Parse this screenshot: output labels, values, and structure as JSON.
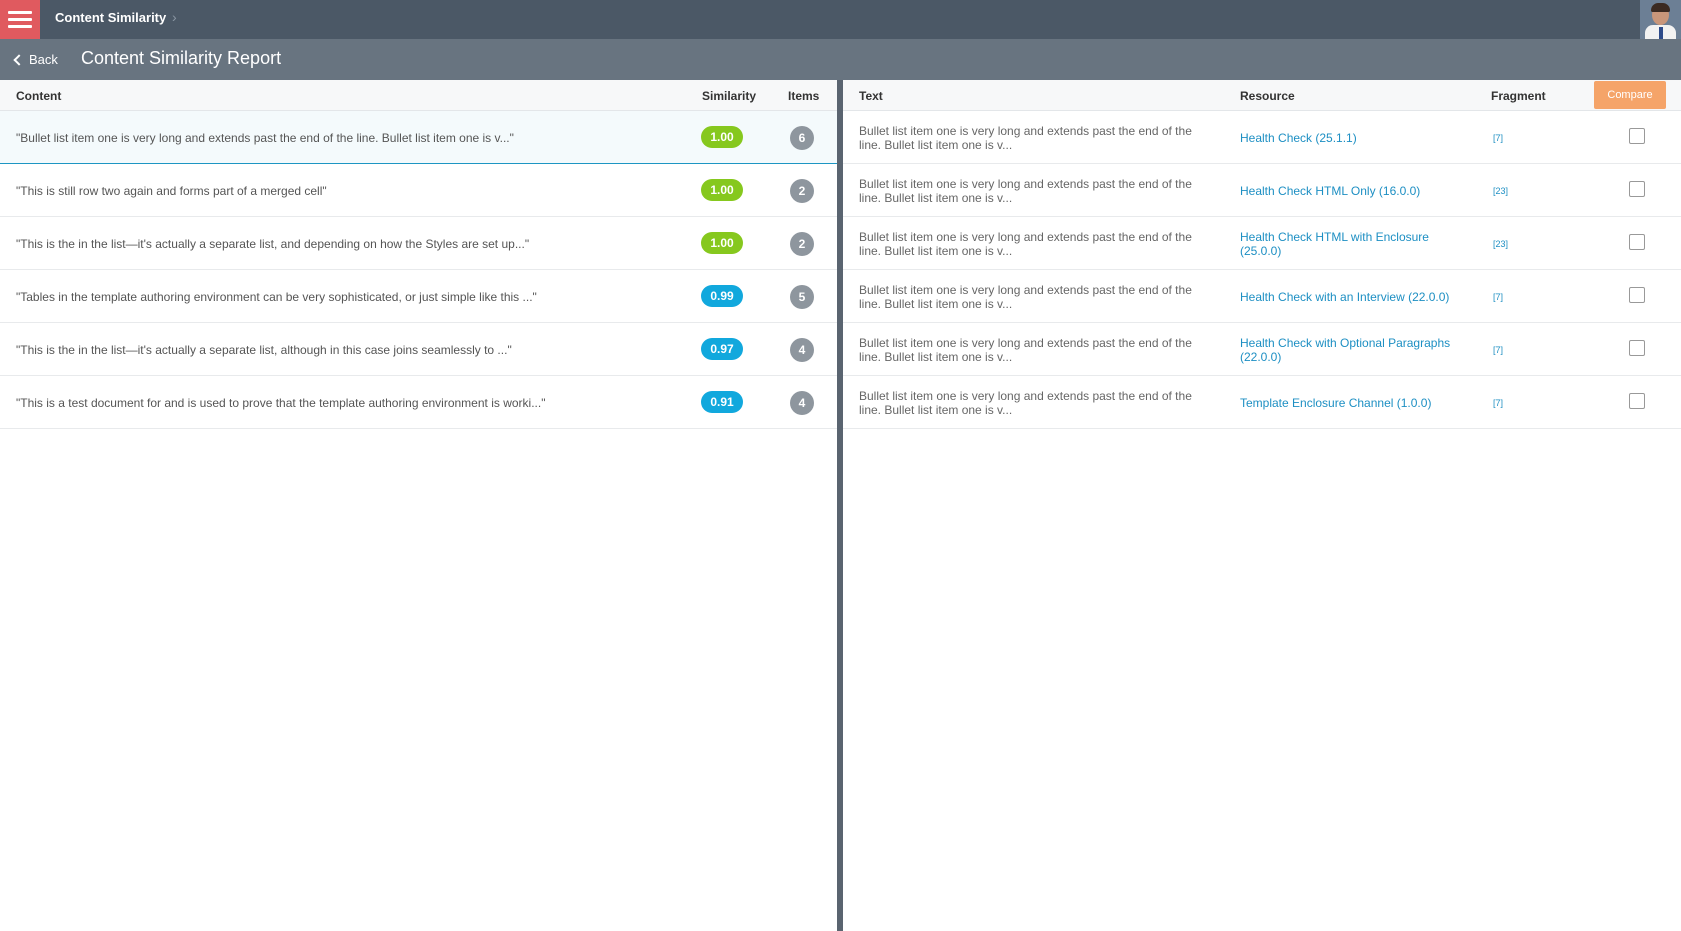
{
  "topbar": {
    "breadcrumb": "Content Similarity",
    "icons": {
      "menu": "hamburger-icon",
      "chevron": "chevron-right-icon",
      "avatar": "user-avatar"
    }
  },
  "subbar": {
    "back_label": "Back",
    "page_title": "Content Similarity Report"
  },
  "left_table": {
    "headers": {
      "content": "Content",
      "similarity": "Similarity",
      "items": "Items"
    },
    "rows": [
      {
        "content": "\"Bullet list item one is very long and extends past the end of the line. Bullet list item one is v...\"",
        "similarity": "1.00",
        "items": "6",
        "color": "#86c81e",
        "selected": true
      },
      {
        "content": "\"This is still row two again and forms part of a merged cell\"",
        "similarity": "1.00",
        "items": "2",
        "color": "#86c81e"
      },
      {
        "content": "\"This is the in the list—it's actually a separate list, and depending on how the Styles are set up...\"",
        "similarity": "1.00",
        "items": "2",
        "color": "#86c81e"
      },
      {
        "content": "\"Tables in the template authoring environment can be very sophisticated, or just simple like this ...\"",
        "similarity": "0.99",
        "items": "5",
        "color": "#11a8dd"
      },
      {
        "content": "\"This is the in the list—it's actually a separate list, although in this case joins seamlessly to ...\"",
        "similarity": "0.97",
        "items": "4",
        "color": "#11a8dd"
      },
      {
        "content": "\"This is a test document for and is used to prove that the template authoring environment is worki...\"",
        "similarity": "0.91",
        "items": "4",
        "color": "#11a8dd"
      }
    ]
  },
  "right_table": {
    "headers": {
      "text": "Text",
      "resource": "Resource",
      "fragment": "Fragment"
    },
    "compare_label": "Compare",
    "rows": [
      {
        "text": "Bullet list item one is very long and extends past the end of the line. Bullet list item one is v...",
        "resource": "Health Check (25.1.1)",
        "fragment": "[7]",
        "checked": false
      },
      {
        "text": "Bullet list item one is very long and extends past the end of the line. Bullet list item one is v...",
        "resource": "Health Check HTML Only (16.0.0)",
        "fragment": "[23]",
        "checked": false
      },
      {
        "text": "Bullet list item one is very long and extends past the end of the line. Bullet list item one is v...",
        "resource": "Health Check HTML with Enclosure (25.0.0)",
        "fragment": "[23]",
        "checked": false
      },
      {
        "text": "Bullet list item one is very long and extends past the end of the line. Bullet list item one is v...",
        "resource": "Health Check with an Interview (22.0.0)",
        "fragment": "[7]",
        "checked": false
      },
      {
        "text": "Bullet list item one is very long and extends past the end of the line. Bullet list item one is v...",
        "resource": "Health Check with Optional Paragraphs (22.0.0)",
        "fragment": "[7]",
        "checked": false
      },
      {
        "text": "Bullet list item one is very long and extends past the end of the line. Bullet list item one is v...",
        "resource": "Template Enclosure Channel (1.0.0)",
        "fragment": "[7]",
        "checked": false
      }
    ]
  }
}
